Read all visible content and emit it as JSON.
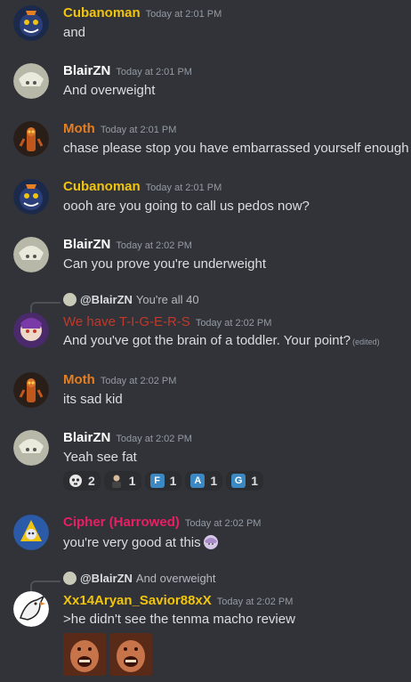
{
  "colors": {
    "background": "#313338",
    "cubanoman": "#f1c40f",
    "moth": "#e67e22",
    "blairzn": "#ffffff",
    "tigers": "#c0392b",
    "cipher": "#e91e63",
    "xx14aryan": "#f1c40f"
  },
  "messages": [
    {
      "author": "Cubanoman",
      "timestamp": "Today at 2:01 PM",
      "text": "and"
    },
    {
      "author": "BlairZN",
      "timestamp": "Today at 2:01 PM",
      "text": "And overweight"
    },
    {
      "author": "Moth",
      "timestamp": "Today at 2:01 PM",
      "text": "chase please stop you have embarrassed yourself enough"
    },
    {
      "author": "Cubanoman",
      "timestamp": "Today at 2:01 PM",
      "text": "oooh are you going to call us pedos now?"
    },
    {
      "author": "BlairZN",
      "timestamp": "Today at 2:02 PM",
      "text": "Can you prove you're underweight"
    },
    {
      "author": "We have T-I-G-E-R-S",
      "timestamp": "Today at 2:02 PM",
      "text": "And you've got the brain of a toddler. Your point?",
      "edited": "(edited)",
      "reply": {
        "author": "@BlairZN",
        "text": "You're all 40"
      }
    },
    {
      "author": "Moth",
      "timestamp": "Today at 2:02 PM",
      "text": "its sad kid"
    },
    {
      "author": "BlairZN",
      "timestamp": "Today at 2:02 PM",
      "text": "Yeah see fat",
      "reactions": [
        {
          "icon": "skull-face-emoji",
          "count": "2"
        },
        {
          "icon": "person-emoji",
          "count": "1"
        },
        {
          "icon": "letter-f-emoji",
          "letter": "F",
          "count": "1"
        },
        {
          "icon": "letter-a-emoji",
          "letter": "A",
          "count": "1"
        },
        {
          "icon": "letter-g-emoji",
          "letter": "G",
          "count": "1"
        }
      ]
    },
    {
      "author": "Cipher (Harrowed)",
      "timestamp": "Today at 2:02 PM",
      "text": "you're very good at this"
    },
    {
      "author": "Xx14Aryan_Savior88xX",
      "timestamp": "Today at 2:02 PM",
      "text": ">he didn't see the tenma macho review",
      "reply": {
        "author": "@BlairZN",
        "text": "And overweight"
      }
    }
  ]
}
